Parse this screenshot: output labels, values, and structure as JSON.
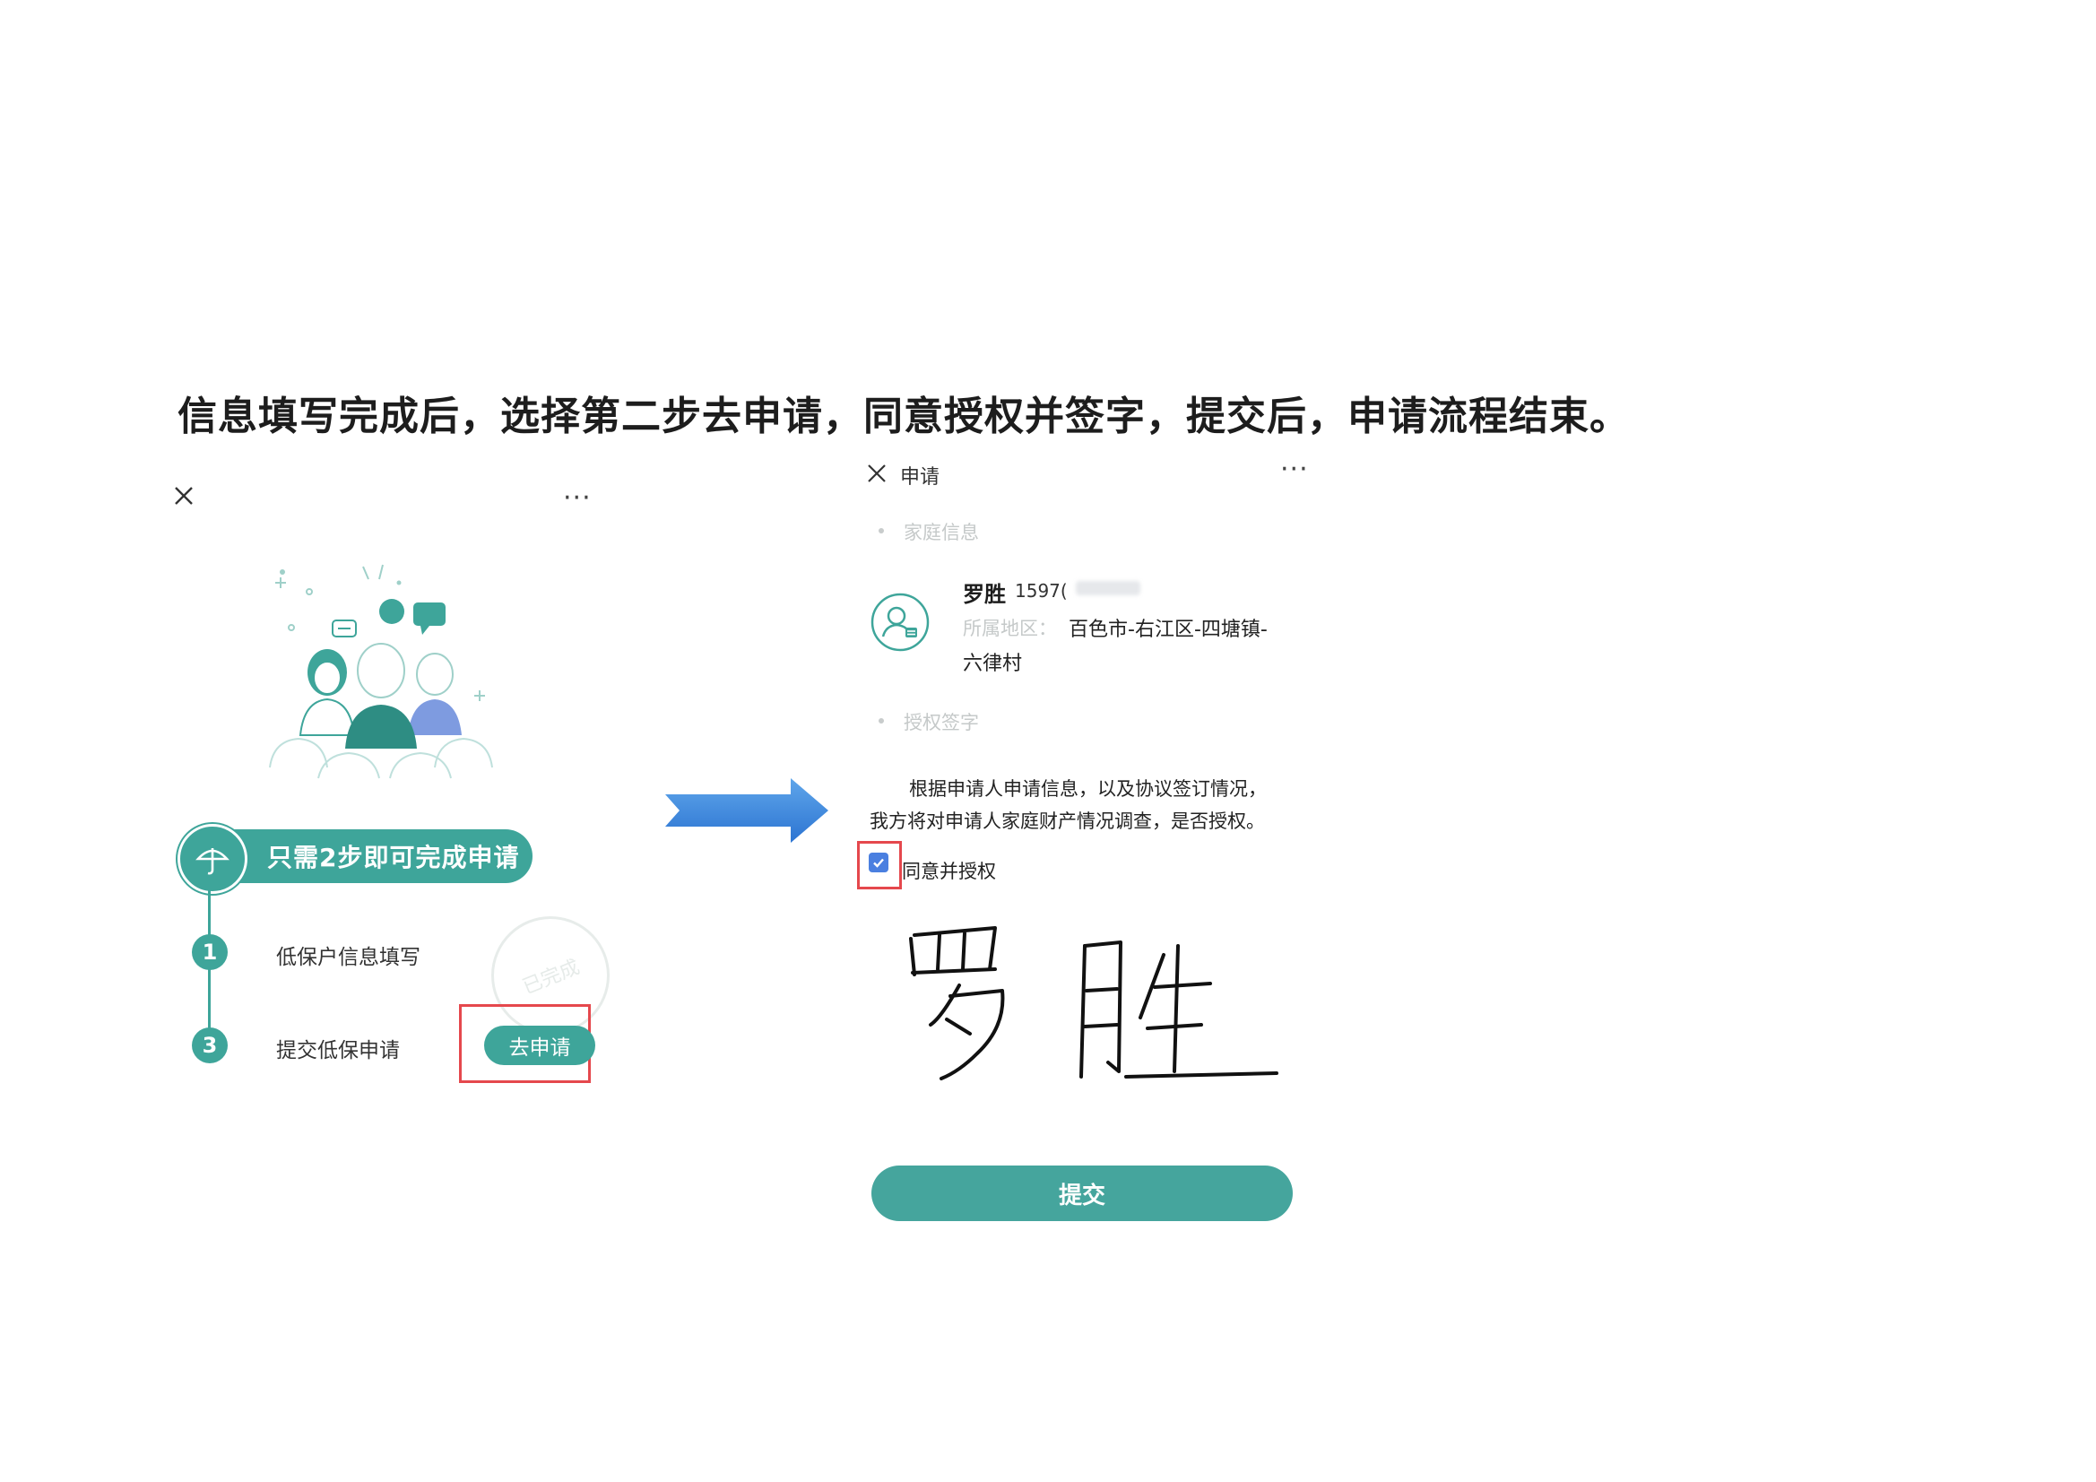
{
  "instruction": "信息填写完成后，选择第二步去申请，同意授权并签字，提交后，申请流程结束。",
  "left_screen": {
    "more_label": "···",
    "banner_text": "只需2步即可完成申请",
    "steps": [
      {
        "number": "1",
        "label": "低保户信息填写"
      },
      {
        "number": "3",
        "label": "提交低保申请"
      }
    ],
    "apply_button": "去申请",
    "stamp_text": "已完成"
  },
  "right_screen": {
    "title": "申请",
    "more_label": "···",
    "section_family": "家庭信息",
    "applicant": {
      "name": "罗胜",
      "phone": "1597(",
      "region_label": "所属地区：",
      "region_line1": "百色市-右江区-四塘镇-",
      "region_line2": "六律村"
    },
    "section_auth": "授权签字",
    "auth_text_line1": "根据申请人申请信息，以及协议签订情况，",
    "auth_text_line2": "我方将对申请人家庭财产情况调查，是否授权。",
    "agree_checked": true,
    "agree_label": "同意并授权",
    "signature_text": "罗胜",
    "submit_label": "提交"
  },
  "colors": {
    "teal": "#3ea59a",
    "highlight_red": "#e5484d",
    "arrow_blue": "#2f7fd8",
    "checkbox_blue": "#4a7fe0"
  }
}
